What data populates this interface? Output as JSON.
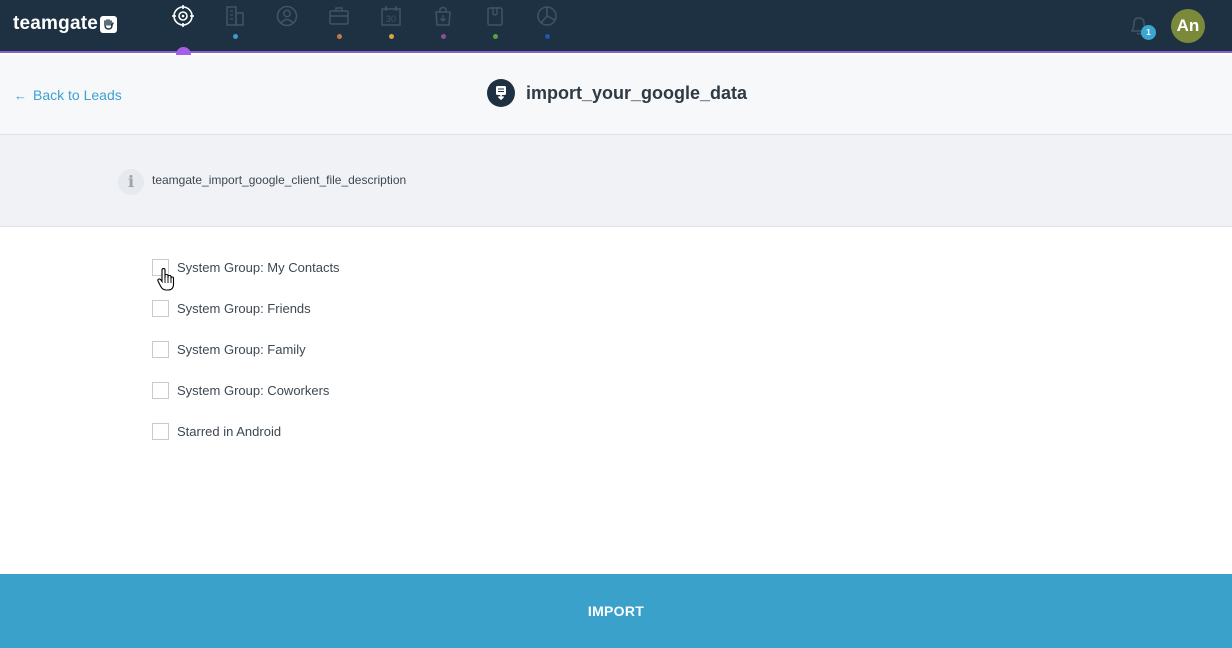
{
  "app": {
    "logo_text": "teamgate"
  },
  "nav": {
    "items": [
      {
        "icon": "target-icon",
        "dot_color": ""
      },
      {
        "icon": "buildings-icon",
        "dot_color": "#3d9ad0"
      },
      {
        "icon": "person-icon",
        "dot_color": ""
      },
      {
        "icon": "briefcase-icon",
        "dot_color": "#c07a4a"
      },
      {
        "icon": "calendar-icon",
        "dot_color": "#d7a442",
        "calendar_number": "30"
      },
      {
        "icon": "shopping-bag-icon",
        "dot_color": "#8a4f8f"
      },
      {
        "icon": "clipboard-icon",
        "dot_color": "#5aa03c"
      },
      {
        "icon": "pie-chart-icon",
        "dot_color": "#2255b0"
      }
    ],
    "active_color": "#a55ee8"
  },
  "notifications": {
    "count": "1"
  },
  "user": {
    "initials": "An",
    "avatar_color": "#7b8a3a"
  },
  "header": {
    "back_label": "Back to Leads",
    "title": "import_your_google_data"
  },
  "info": {
    "text": "teamgate_import_google_client_file_description",
    "icon_glyph": "i"
  },
  "groups": [
    {
      "label": "System Group: My Contacts",
      "checked": false
    },
    {
      "label": "System Group: Friends",
      "checked": false
    },
    {
      "label": "System Group: Family",
      "checked": false
    },
    {
      "label": "System Group: Coworkers",
      "checked": false
    },
    {
      "label": "Starred in Android",
      "checked": false
    }
  ],
  "footer": {
    "import_label": "IMPORT",
    "color": "#3aa1cb"
  }
}
